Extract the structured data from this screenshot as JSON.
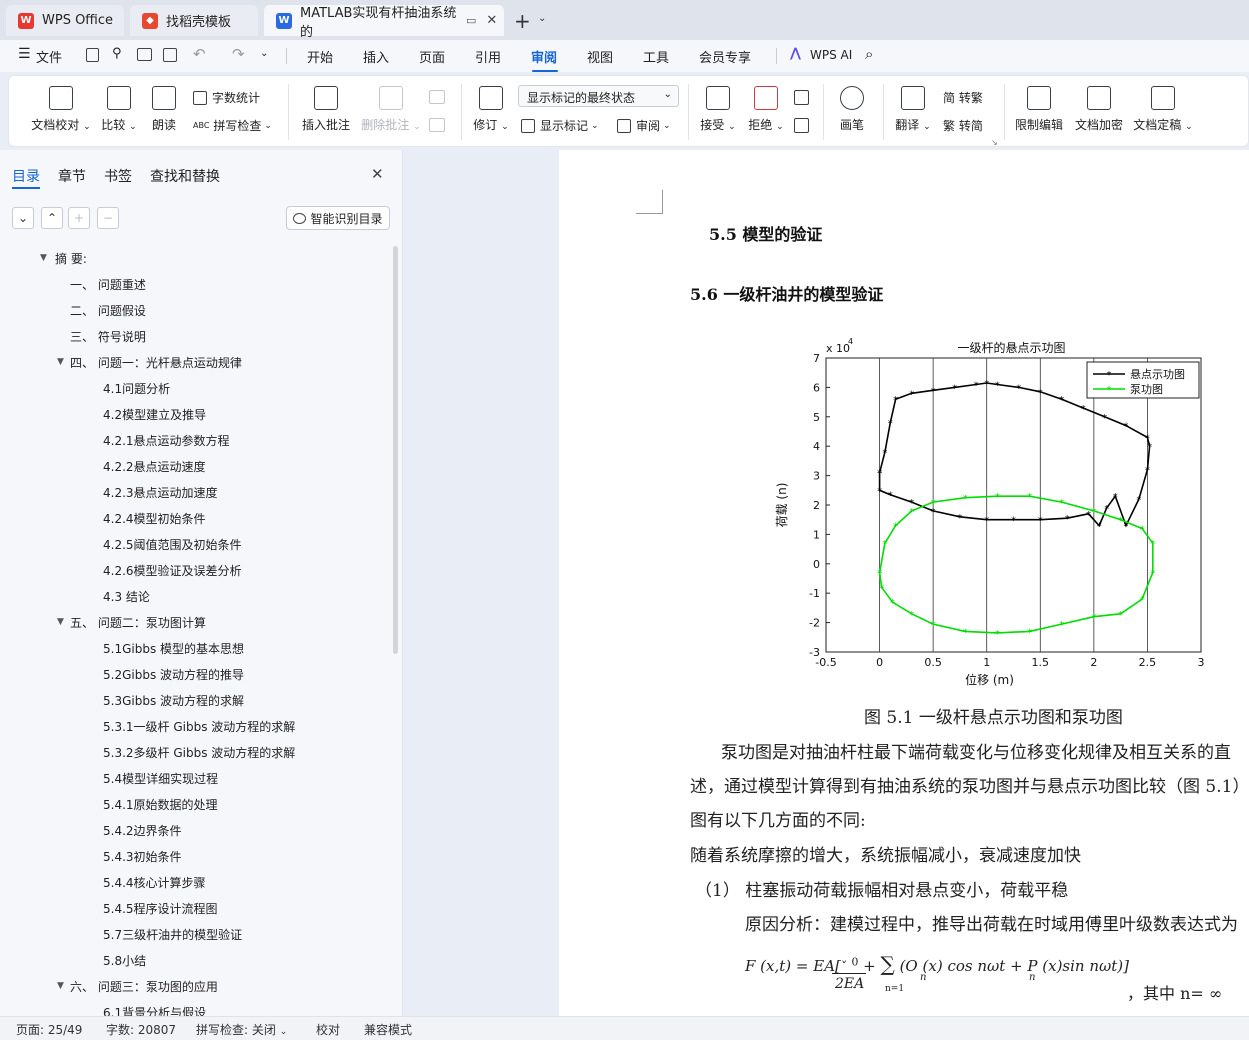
{
  "tabs": [
    {
      "label": "WPS Office",
      "icon": "wps-logo-icon"
    },
    {
      "label": "找稻壳模板",
      "icon": "docer-icon"
    },
    {
      "label": "MATLAB实现有杆抽油系统的",
      "icon": "word-doc-icon"
    }
  ],
  "menu": {
    "file": "文件",
    "items": [
      "开始",
      "插入",
      "页面",
      "引用",
      "审阅",
      "视图",
      "工具",
      "会员专享"
    ],
    "active": "审阅",
    "wps_ai": "WPS AI"
  },
  "ribbon": {
    "doc_check": "文档校对",
    "compare": "比较",
    "read_aloud": "朗读",
    "word_count": "字数统计",
    "spell_check": "拼写检查",
    "insert_comment": "插入批注",
    "delete_comment": "删除批注",
    "revise": "修订",
    "markup_state": "显示标记的最终状态",
    "show_markup": "显示标记",
    "review": "审阅",
    "accept": "接受",
    "reject": "拒绝",
    "pen": "画笔",
    "translate": "翻译",
    "to_traditional": "简 转繁",
    "to_simplified": "繁 转简",
    "restrict_edit": "限制编辑",
    "encrypt": "文档加密",
    "finalize": "文档定稿"
  },
  "nav": {
    "tabs": [
      "目录",
      "章节",
      "书签",
      "查找和替换"
    ],
    "smart_toc": "智能识别目录",
    "toc": [
      {
        "text": "摘 要:",
        "level": 0,
        "arrow": true
      },
      {
        "text": "一、 问题重述",
        "level": 1,
        "arrow": false
      },
      {
        "text": "二、 问题假设",
        "level": 1,
        "arrow": false
      },
      {
        "text": "三、 符号说明",
        "level": 1,
        "arrow": false
      },
      {
        "text": "四、 问题一：光杆悬点运动规律",
        "level": 1,
        "arrow": true
      },
      {
        "text": "4.1问题分析",
        "level": 2,
        "arrow": false
      },
      {
        "text": "4.2模型建立及推导",
        "level": 2,
        "arrow": false
      },
      {
        "text": "4.2.1悬点运动参数方程",
        "level": 2,
        "arrow": false
      },
      {
        "text": "4.2.2悬点运动速度",
        "level": 2,
        "arrow": false
      },
      {
        "text": "4.2.3悬点运动加速度",
        "level": 2,
        "arrow": false
      },
      {
        "text": "4.2.4模型初始条件",
        "level": 2,
        "arrow": false
      },
      {
        "text": "4.2.5阈值范围及初始条件",
        "level": 2,
        "arrow": false
      },
      {
        "text": "4.2.6模型验证及误差分析",
        "level": 2,
        "arrow": false
      },
      {
        "text": "4.3 结论",
        "level": 2,
        "arrow": false
      },
      {
        "text": "五、 问题二：泵功图计算",
        "level": 1,
        "arrow": true
      },
      {
        "text": "5.1Gibbs 模型的基本思想",
        "level": 2,
        "arrow": false
      },
      {
        "text": "5.2Gibbs 波动方程的推导",
        "level": 2,
        "arrow": false
      },
      {
        "text": "5.3Gibbs 波动方程的求解",
        "level": 2,
        "arrow": false
      },
      {
        "text": "5.3.1一级杆 Gibbs 波动方程的求解",
        "level": 2,
        "arrow": false
      },
      {
        "text": "5.3.2多级杆 Gibbs 波动方程的求解",
        "level": 2,
        "arrow": false
      },
      {
        "text": "5.4模型详细实现过程",
        "level": 2,
        "arrow": false
      },
      {
        "text": "5.4.1原始数据的处理",
        "level": 2,
        "arrow": false
      },
      {
        "text": "5.4.2边界条件",
        "level": 2,
        "arrow": false
      },
      {
        "text": "5.4.3初始条件",
        "level": 2,
        "arrow": false
      },
      {
        "text": "5.4.4核心计算步骤",
        "level": 2,
        "arrow": false
      },
      {
        "text": "5.4.5程序设计流程图",
        "level": 2,
        "arrow": false
      },
      {
        "text": "5.7三级杆油井的模型验证",
        "level": 2,
        "arrow": false
      },
      {
        "text": "5.8小结",
        "level": 2,
        "arrow": false
      },
      {
        "text": "六、 问题三：泵功图的应用",
        "level": 1,
        "arrow": true
      },
      {
        "text": "6.1背景分析与假设",
        "level": 2,
        "arrow": false
      }
    ]
  },
  "doc": {
    "h55": "5.5 模型的验证",
    "h56": "5.6  一级杆油井的模型验证",
    "caption": "图  5.1 一级杆悬点示功图和泵功图",
    "p1": "泵功图是对抽油杆柱最下端荷载变化与位移变化规律及相互关系的直",
    "p2": "述，通过模型计算得到有抽油系统的泵功图并与悬点示功图比较（图 5.1）",
    "p3": "图有以下几方面的不同:",
    "p4": "随着系统摩擦的增大，系统振幅减小，衰减速度加快",
    "p5": "（1）  柱塞振动荷载振幅相对悬点变小，荷载平稳",
    "p6": "原因分析：建模过程中，推导出荷载在时域用傅里叶级数表达式为",
    "formula": "F (x,t) = EA[",
    "formula_tail": "其中  n= ∞"
  },
  "chart_data": {
    "type": "line",
    "title": "一级杆的悬点示功图",
    "xlabel": "位移 (m)",
    "ylabel": "荷载 (n)",
    "y_exponent": "x 10^4",
    "xlim": [
      -0.5,
      3
    ],
    "ylim": [
      -3,
      7
    ],
    "xticks": [
      "-0.5",
      "0",
      "0.5",
      "1",
      "1.5",
      "2",
      "2.5",
      "3"
    ],
    "yticks": [
      "-3",
      "-2",
      "-1",
      "0",
      "1",
      "2",
      "3",
      "4",
      "5",
      "6",
      "7"
    ],
    "grid": "vertical",
    "legend_position": "top-right",
    "series": [
      {
        "name": "悬点示功图",
        "color": "#000000",
        "marker": "*",
        "x": [
          0.0,
          0.05,
          0.1,
          0.15,
          0.3,
          0.5,
          0.7,
          0.9,
          1.0,
          1.1,
          1.3,
          1.5,
          1.7,
          1.9,
          2.1,
          2.3,
          2.5,
          2.52,
          2.5,
          2.42,
          2.3,
          2.2,
          2.12,
          2.05,
          1.95,
          1.75,
          1.5,
          1.25,
          1.0,
          0.75,
          0.5,
          0.3,
          0.1,
          0.0,
          0.0
        ],
        "y": [
          3.1,
          3.8,
          4.8,
          5.6,
          5.8,
          5.9,
          6.0,
          6.1,
          6.15,
          6.1,
          6.0,
          5.85,
          5.6,
          5.3,
          5.0,
          4.7,
          4.3,
          4.0,
          3.2,
          2.2,
          1.3,
          2.3,
          1.9,
          1.3,
          1.7,
          1.55,
          1.5,
          1.5,
          1.5,
          1.6,
          1.8,
          2.1,
          2.35,
          2.5,
          3.1
        ]
      },
      {
        "name": "泵功图",
        "color": "#00dd00",
        "marker": "*",
        "x": [
          0.0,
          0.05,
          0.15,
          0.3,
          0.5,
          0.8,
          1.1,
          1.4,
          1.7,
          2.0,
          2.25,
          2.45,
          2.55,
          2.55,
          2.45,
          2.25,
          2.0,
          1.7,
          1.4,
          1.1,
          0.8,
          0.5,
          0.3,
          0.12,
          0.02,
          0.0
        ],
        "y": [
          -0.3,
          0.7,
          1.3,
          1.8,
          2.1,
          2.25,
          2.3,
          2.3,
          2.1,
          1.8,
          1.5,
          1.2,
          0.7,
          -0.3,
          -1.2,
          -1.7,
          -1.8,
          -2.05,
          -2.3,
          -2.35,
          -2.3,
          -2.05,
          -1.7,
          -1.3,
          -0.8,
          -0.3
        ]
      }
    ]
  },
  "status": {
    "page": "页面: 25/49",
    "words": "字数: 20807",
    "spell": "拼写检查: 关闭",
    "proof": "校对",
    "compat": "兼容模式"
  }
}
